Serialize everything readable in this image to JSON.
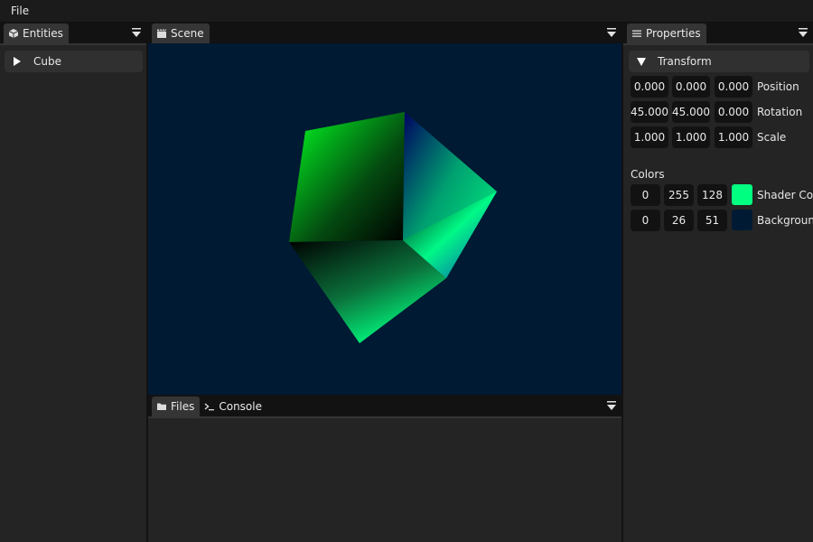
{
  "menubar": {
    "items": [
      "File"
    ]
  },
  "entities": {
    "tab_label": "Entities",
    "items": [
      {
        "label": "Cube"
      }
    ]
  },
  "scene": {
    "tab_label": "Scene",
    "background_color": "#001a33"
  },
  "bottom": {
    "tabs": [
      {
        "label": "Files",
        "icon": "folder-icon"
      },
      {
        "label": "Console",
        "icon": "terminal-icon"
      }
    ]
  },
  "properties": {
    "tab_label": "Properties",
    "transform": {
      "header": "Transform",
      "position": {
        "label": "Position",
        "values": [
          "0.000",
          "0.000",
          "0.000"
        ]
      },
      "rotation": {
        "label": "Rotation",
        "values": [
          "45.000",
          "45.000",
          "0.000"
        ]
      },
      "scale": {
        "label": "Scale",
        "values": [
          "1.000",
          "1.000",
          "1.000"
        ]
      }
    },
    "colors": {
      "heading": "Colors",
      "shader": {
        "label": "Shader Col",
        "values": [
          "0",
          "255",
          "128"
        ],
        "swatch": "#00ff80"
      },
      "background": {
        "label": "Backgroun",
        "values": [
          "0",
          "26",
          "51"
        ],
        "swatch": "#001a33"
      }
    }
  }
}
